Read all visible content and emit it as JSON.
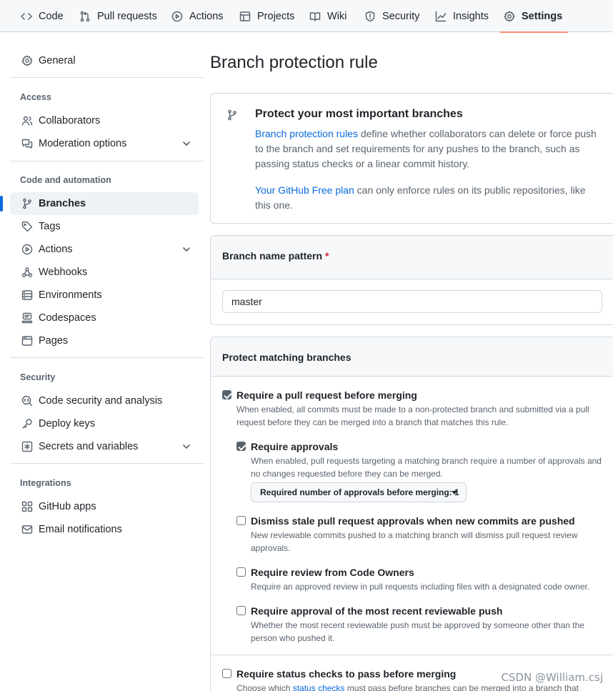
{
  "tabs": [
    {
      "label": "Code",
      "icon": "code-icon"
    },
    {
      "label": "Pull requests",
      "icon": "git-pull-request-icon"
    },
    {
      "label": "Actions",
      "icon": "play-icon"
    },
    {
      "label": "Projects",
      "icon": "table-icon"
    },
    {
      "label": "Wiki",
      "icon": "book-icon"
    },
    {
      "label": "Security",
      "icon": "shield-icon"
    },
    {
      "label": "Insights",
      "icon": "graph-icon"
    },
    {
      "label": "Settings",
      "icon": "gear-icon",
      "active": true
    }
  ],
  "sidebar": {
    "general": "General",
    "access_heading": "Access",
    "access": [
      "Collaborators",
      "Moderation options"
    ],
    "code_heading": "Code and automation",
    "code": [
      "Branches",
      "Tags",
      "Actions",
      "Webhooks",
      "Environments",
      "Codespaces",
      "Pages"
    ],
    "security_heading": "Security",
    "security": [
      "Code security and analysis",
      "Deploy keys",
      "Secrets and variables"
    ],
    "integrations_heading": "Integrations",
    "integrations": [
      "GitHub apps",
      "Email notifications"
    ]
  },
  "main": {
    "title": "Branch protection rule",
    "intro": {
      "title": "Protect your most important branches",
      "link1": "Branch protection rules",
      "text1": " define whether collaborators can delete or force push to the branch and set requirements for any pushes to the branch, such as passing status checks or a linear commit history.",
      "link2": "Your GitHub Free plan",
      "text2": " can only enforce rules on its public repositories, like this one."
    },
    "pattern": {
      "label": "Branch name pattern",
      "required_mark": "*",
      "value": "master"
    },
    "protect": {
      "heading": "Protect matching branches",
      "pr": {
        "title": "Require a pull request before merging",
        "desc": "When enabled, all commits must be made to a non-protected branch and submitted via a pull request before they can be merged into a branch that matches this rule.",
        "checked": true
      },
      "approvals": {
        "title": "Require approvals",
        "desc": "When enabled, pull requests targeting a matching branch require a number of approvals and no changes requested before they can be merged.",
        "checked": true,
        "select_label": "Required number of approvals before merging: 1"
      },
      "dismiss": {
        "title": "Dismiss stale pull request approvals when new commits are pushed",
        "desc": "New reviewable commits pushed to a matching branch will dismiss pull request review approvals.",
        "checked": false
      },
      "owners": {
        "title": "Require review from Code Owners",
        "desc": "Require an approved review in pull requests including files with a designated code owner.",
        "checked": false
      },
      "recent": {
        "title": "Require approval of the most recent reviewable push",
        "desc": "Whether the most recent reviewable push must be approved by someone other than the person who pushed it.",
        "checked": false
      },
      "status": {
        "title": "Require status checks to pass before merging",
        "desc_pre": "Choose which ",
        "desc_link": "status checks",
        "desc_post": " must pass before branches can be merged into a branch that",
        "checked": false
      }
    }
  },
  "watermark": "CSDN @William.csj",
  "colors": {
    "accent": "#0969da",
    "tab_underline": "#fd8c73",
    "required": "#d1242f"
  }
}
